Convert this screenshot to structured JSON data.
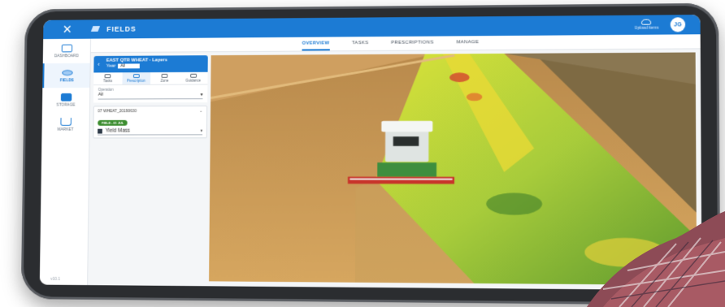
{
  "app": {
    "close_icon": "close-icon",
    "brand_name": "FIELDS",
    "upload_label": "Upload items",
    "avatar_initials": "JG",
    "accent_color": "#1c7bd4"
  },
  "tabs": [
    {
      "label": "OVERVIEW",
      "active": true
    },
    {
      "label": "TASKS",
      "active": false
    },
    {
      "label": "PRESCRIPTIONS",
      "active": false
    },
    {
      "label": "MANAGE",
      "active": false
    }
  ],
  "sidebar": {
    "items": [
      {
        "label": "DASHBOARD",
        "icon": "monitor-icon"
      },
      {
        "label": "FIELDS",
        "icon": "fields-icon",
        "active": true
      },
      {
        "label": "STORAGE",
        "icon": "storage-icon"
      },
      {
        "label": "MARKET",
        "icon": "cart-icon"
      }
    ],
    "version": "v10.1"
  },
  "panel": {
    "title": "EAST QTR WHEAT - Layers",
    "year_label": "Year",
    "year_value": "All",
    "tools": [
      {
        "label": "Tasks"
      },
      {
        "label": "Prescription",
        "active": true
      },
      {
        "label": "Zone"
      },
      {
        "label": "Guidance"
      }
    ],
    "operation_label": "Operation",
    "operation_value": "All",
    "layer": {
      "name": "07 WHEAT_20190630",
      "badge": "FIELD - 01 JUL",
      "selection": "Yield Mass"
    }
  }
}
